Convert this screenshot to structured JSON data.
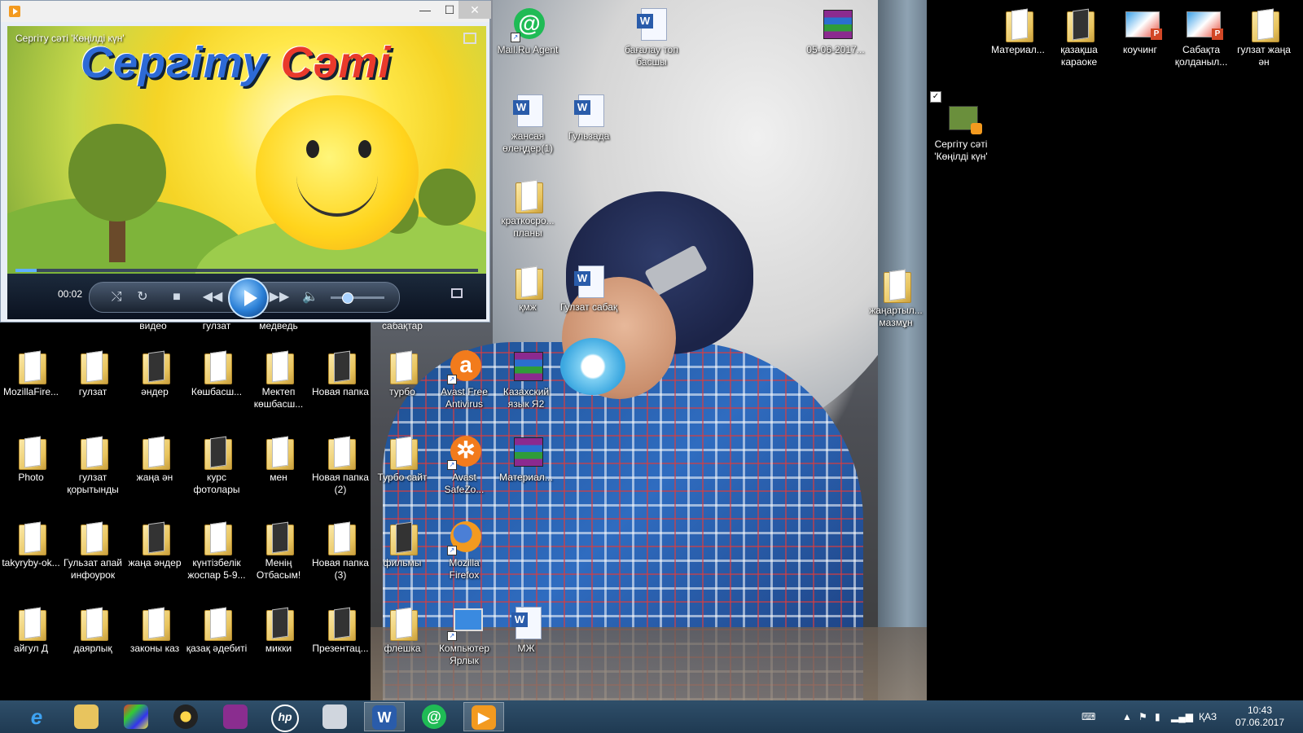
{
  "player": {
    "caption": "Сергіту сәті 'Көңілді күн'",
    "art_word1": "Сергіту",
    "art_word2": "Сәті",
    "time": "00:02",
    "progress_fraction": 0.045,
    "volume_fraction": 0.3,
    "min_glyph": "—",
    "max_glyph": "☐",
    "close_glyph": "✕"
  },
  "desktop_icons": {
    "mailru_agent": "Mail.Ru Agent",
    "bagalau": "бағалау топ басшы",
    "rar_date": "05-06-2017...",
    "material_top": "Материал...",
    "kazaksha_karaoke": "қазақша караоке",
    "kouching": "коучинг",
    "sabakta": "Сабақта қолданыл...",
    "gulzat_zhana_an": "гулзат жаңа ән",
    "video_file": "Сергіту сәті 'Көңілді күн'",
    "zhansaya": "жансая өлеңдер(1)",
    "gulzada": "Гульзада",
    "kratkosro": "краткосро... планы",
    "kmzh": "қмж",
    "gulzat_sabak": "Гулзат сабақ",
    "zhanartyl": "жаңартыл... мазмұн",
    "video_partial": "видео",
    "gulzat_partial": "гулзат",
    "medved_partial": "медведь",
    "sabaktar_partial": "сабақтар",
    "mozilla_folder": "MozillaFire...",
    "gulzat2": "гулзат",
    "ander": "әндер",
    "koshbas": "Көшбасш...",
    "mektep": "Мектеп көшбасш...",
    "new_folder": "Новая папка",
    "turbo": "турбо",
    "avast_free": "Avast Free Antivirus",
    "kazakh_yazyk": "Казахский язык Я2",
    "photo": "Photo",
    "gulzat_korytyndy": "гулзат қорытынды",
    "zhana_an": "жаңа ән",
    "kurs": "курс фотолары",
    "men": "мен",
    "new_folder2": "Новая папка (2)",
    "turbo_sait": "Турбо сайт",
    "avast_safezone": "Avast SafeZo...",
    "material_mid": "Материал...",
    "takyryby": "takyryby-ok...",
    "gulzat_apai": "Гульзат апай инфоурок",
    "zhana_ander": "жаңа әндер",
    "kuntizbelik": "күнтізбелік жоспар 5-9...",
    "menin_otbasym": "Менің Отбасым!",
    "new_folder3": "Новая папка (3)",
    "filmy": "фильмы",
    "mozilla_firefox": "Mozilla Firefox",
    "aigul": "айгул Д",
    "dayarlyk": "даярлық",
    "zakony": "законы каз",
    "kazak_adebieti": "қазақ әдебиті",
    "mikki": "микки",
    "prezentac": "Презентац...",
    "fleshka": "флешка",
    "komputer": "Компьютер Ярлык",
    "mzh": "МЖ"
  },
  "taskbar": {
    "language": "ҚАЗ",
    "time": "10:43",
    "date": "07.06.2017",
    "w_glyph": "W",
    "at_glyph": "@",
    "hp_glyph": "hp",
    "e_glyph": "e"
  },
  "colors": {
    "taskbar": "#2a4a66",
    "accent_blue": "#2a7fd6",
    "folder_yellow": "#e8c45e"
  }
}
